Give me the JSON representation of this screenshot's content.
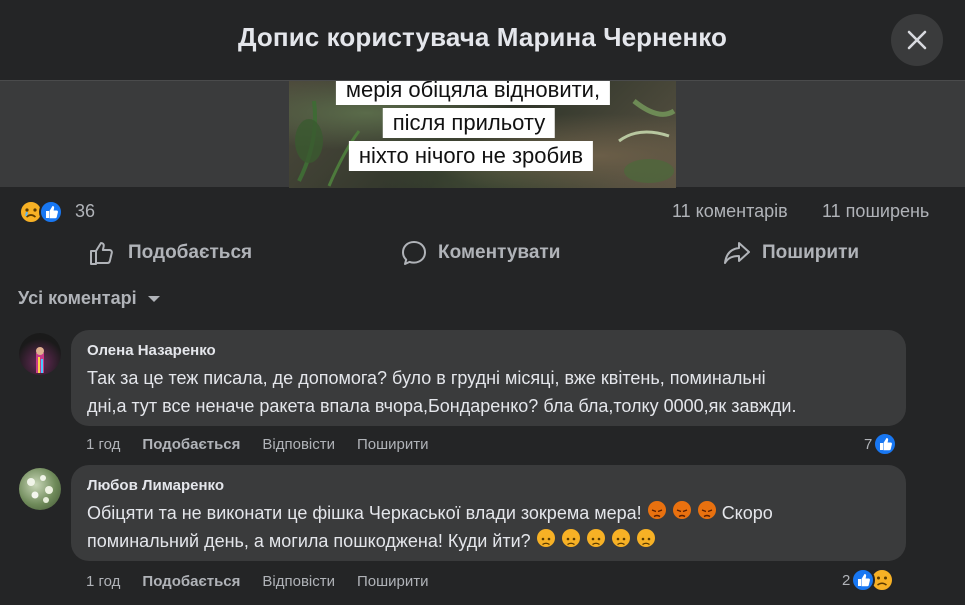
{
  "dialog": {
    "title": "Допис користувача Марина Черненко"
  },
  "post": {
    "image_caption": [
      "мерія обіцяла відновити,",
      "після прильоту",
      "ніхто нічого не зробив"
    ],
    "reactions_count": "36",
    "comments_count": "11 коментарів",
    "shares_count": "11 поширень"
  },
  "actions": {
    "like": "Подобається",
    "comment": "Коментувати",
    "share": "Поширити"
  },
  "comments_filter": "Усі коментарі",
  "comments": [
    {
      "author": "Олена Назаренко",
      "text_lines": [
        "Так за це теж писала, де допомога? було в грудні місяці, вже квітень, поминальні",
        "дні,а тут все неначе ракета впала вчора,Бондаренко? бла бла,толку 0000,як завжди."
      ],
      "time": "1 год",
      "like": "Подобається",
      "reply": "Відповісти",
      "share": "Поширити",
      "reaction_count": "7"
    },
    {
      "author": "Любов Лимаренко",
      "text_line1": "Обіцяти та не виконати це фішка Черкаської влади зокрема мера!",
      "text_line1_after": "Скоро",
      "text_line2": "поминальний день, а могила пошкоджена! Куди йти?",
      "time": "1 год",
      "like": "Подобається",
      "reply": "Відповісти",
      "share": "Поширити",
      "reaction_count": "2"
    }
  ],
  "colors": {
    "background": "#242526",
    "bubble": "#3a3b3c",
    "like_blue": "#1877f2",
    "angry": "#e9710f",
    "sad": "#f7b125"
  }
}
